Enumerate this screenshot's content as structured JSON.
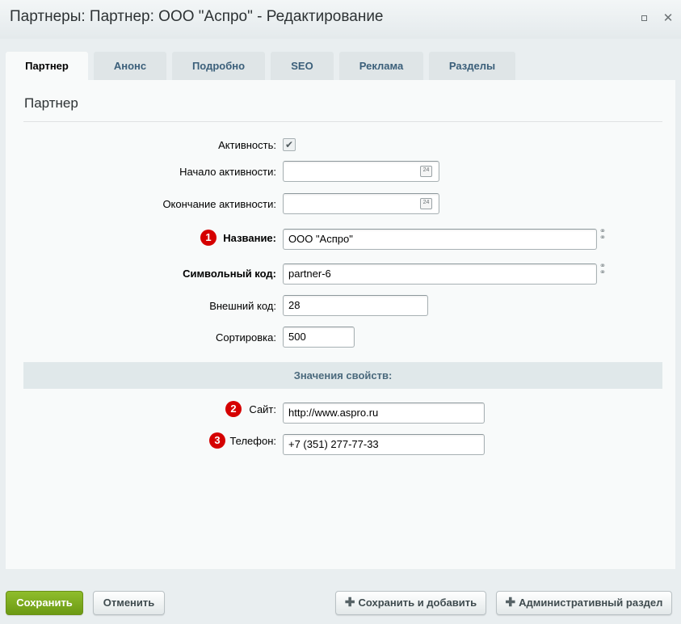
{
  "window": {
    "title": "Партнеры: Партнер: ООО \"Аспро\" - Редактирование"
  },
  "tabs": [
    {
      "label": "Партнер"
    },
    {
      "label": "Анонс"
    },
    {
      "label": "Подробно"
    },
    {
      "label": "SEO"
    },
    {
      "label": "Реклама"
    },
    {
      "label": "Разделы"
    }
  ],
  "section": {
    "title": "Партнер"
  },
  "form": {
    "active_label": "Активность:",
    "active_checked": true,
    "start_label": "Начало активности:",
    "start_value": "",
    "end_label": "Окончание активности:",
    "end_value": "",
    "calendar_day": "24",
    "name_label": "Название:",
    "name_value": "ООО \"Аспро\"",
    "code_label": "Символьный код:",
    "code_value": "partner-6",
    "ext_label": "Внешний код:",
    "ext_value": "28",
    "sort_label": "Сортировка:",
    "sort_value": "500"
  },
  "props": {
    "header": "Значения свойств:",
    "site_label": "Сайт:",
    "site_value": "http://www.aspro.ru",
    "phone_label": "Телефон:",
    "phone_value": "+7  (351) 277-77-33"
  },
  "badges": {
    "one": "1",
    "two": "2",
    "three": "3"
  },
  "footer": {
    "save": "Сохранить",
    "cancel": "Отменить",
    "save_add": "Сохранить и добавить",
    "admin": "Административный раздел"
  },
  "colors": {
    "accent_green": "#7aaa1e",
    "badge_red": "#d50000"
  }
}
